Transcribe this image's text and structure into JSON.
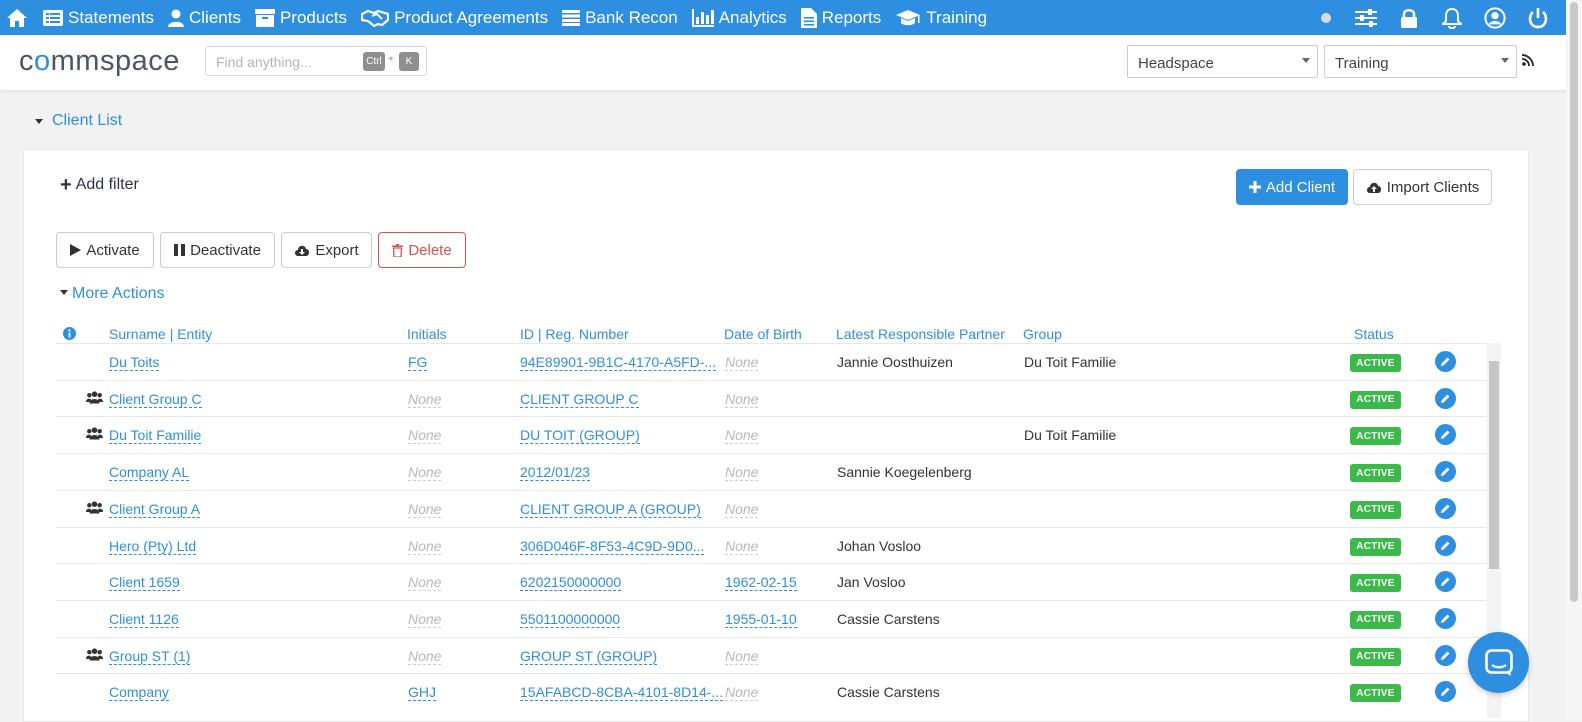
{
  "nav": {
    "items": [
      {
        "label": "Statements",
        "icon": "list-icon"
      },
      {
        "label": "Clients",
        "icon": "user-icon"
      },
      {
        "label": "Products",
        "icon": "box-icon"
      },
      {
        "label": "Product Agreements",
        "icon": "handshake-icon"
      },
      {
        "label": "Bank Recon",
        "icon": "table-icon"
      },
      {
        "label": "Analytics",
        "icon": "bar-chart-icon"
      },
      {
        "label": "Reports",
        "icon": "document-icon"
      },
      {
        "label": "Training",
        "icon": "graduation-cap-icon"
      }
    ],
    "right_icons": [
      "status-dot-icon",
      "sliders-icon",
      "lock-icon",
      "bell-icon",
      "user-circle-icon",
      "power-icon"
    ]
  },
  "header": {
    "logo_parts": [
      "c",
      "o",
      "mmspace"
    ],
    "search_placeholder": "Find anything...",
    "kbd_ctrl": "Ctrl",
    "kbd_plus": "+",
    "kbd_k": "K",
    "workspace": "Headspace",
    "environment": "Training"
  },
  "section": {
    "title": "Client List"
  },
  "toolbar": {
    "add_filter": "Add filter",
    "add_client": "Add Client",
    "import_clients": "Import Clients",
    "activate": "Activate",
    "deactivate": "Deactivate",
    "export": "Export",
    "delete": "Delete",
    "more_actions": "More Actions"
  },
  "table": {
    "columns": [
      "Surname | Entity",
      "Initials",
      "ID | Reg. Number",
      "Date of Birth",
      "Latest Responsible Partner",
      "Group",
      "Status"
    ],
    "rows": [
      {
        "group_icon": false,
        "name": "Du Toits",
        "initials": "FG",
        "id": "94E89901-9B1C-4170-A5FD-...",
        "dob": "None",
        "partner": "Jannie Oosthuizen",
        "group": "Du Toit Familie",
        "status": "ACTIVE"
      },
      {
        "group_icon": true,
        "name": "Client Group C",
        "initials": "None",
        "id": "CLIENT GROUP C",
        "dob": "None",
        "partner": "",
        "group": "",
        "status": "ACTIVE"
      },
      {
        "group_icon": true,
        "name": "Du Toit Familie",
        "initials": "None",
        "id": "DU TOIT (GROUP)",
        "dob": "None",
        "partner": "",
        "group": "Du Toit Familie",
        "status": "ACTIVE"
      },
      {
        "group_icon": false,
        "name": "Company AL",
        "initials": "None",
        "id": "2012/01/23",
        "dob": "None",
        "partner": "Sannie Koegelenberg",
        "group": "",
        "status": "ACTIVE"
      },
      {
        "group_icon": true,
        "name": "Client Group A",
        "initials": "None",
        "id": "CLIENT GROUP A (GROUP)",
        "dob": "None",
        "partner": "",
        "group": "",
        "status": "ACTIVE"
      },
      {
        "group_icon": false,
        "name": "Hero (Pty) Ltd",
        "initials": "None",
        "id": "306D046F-8F53-4C9D-9D0...",
        "dob": "None",
        "partner": "Johan Vosloo",
        "group": "",
        "status": "ACTIVE"
      },
      {
        "group_icon": false,
        "name": "Client 1659",
        "initials": "None",
        "id": "6202150000000",
        "dob": "1962-02-15",
        "partner": "Jan Vosloo",
        "group": "",
        "status": "ACTIVE"
      },
      {
        "group_icon": false,
        "name": "Client 1126",
        "initials": "None",
        "id": "5501100000000",
        "dob": "1955-01-10",
        "partner": "Cassie Carstens",
        "group": "",
        "status": "ACTIVE"
      },
      {
        "group_icon": true,
        "name": "Group ST (1)",
        "initials": "None",
        "id": "GROUP ST (GROUP)",
        "dob": "None",
        "partner": "",
        "group": "",
        "status": "ACTIVE"
      },
      {
        "group_icon": false,
        "name": "Company",
        "initials": "GHJ",
        "id": "15AFABCD-8CBA-4101-8D14-...",
        "dob": "None",
        "partner": "Cassie Carstens",
        "group": "",
        "status": "ACTIVE"
      }
    ]
  },
  "colors": {
    "primary": "#2e8fe0",
    "active_badge": "#3cb94b",
    "danger": "#d9534f"
  }
}
